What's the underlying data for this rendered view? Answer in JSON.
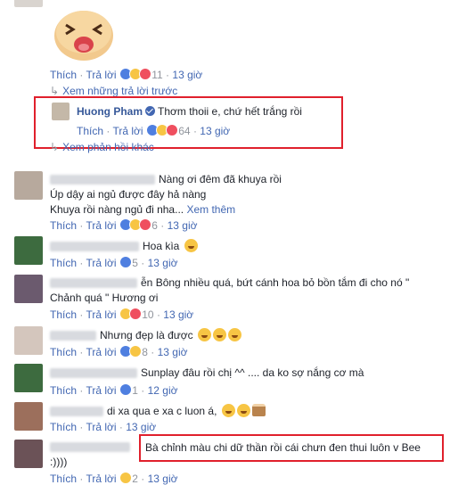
{
  "comments": {
    "sticker": {
      "actions": {
        "like": "Thích",
        "reply": "Trả lời",
        "count": "11",
        "time": "13 giờ"
      }
    },
    "prev_replies": "Xem những trả lời trước",
    "huong": {
      "author": "Huong Pham",
      "text": "Thơm thoii e, chứ hết trắng rồi",
      "actions": {
        "like": "Thích",
        "reply": "Trả lời",
        "count": "64",
        "time": "13 giờ"
      }
    },
    "other_replies": "Xem phản hồi khác",
    "c1": {
      "lines": [
        "Nàng ơi đêm đã khuya rồi",
        "Úp dậy ai ngủ được đây hả nàng",
        "Khuya rồi nàng ngủ đi nha..."
      ],
      "see_more": "Xem thêm",
      "actions": {
        "like": "Thích",
        "reply": "Trả lời",
        "count": "6",
        "time": "13 giờ"
      }
    },
    "c2": {
      "text": "Hoa kìa",
      "actions": {
        "like": "Thích",
        "reply": "Trả lời",
        "count": "5",
        "time": "13 giờ"
      }
    },
    "c3": {
      "name_suffix": "ễn",
      "lines": [
        "Bông nhiều quá, bứt cánh hoa bỏ bồn tắm đi cho nó \"",
        "Chảnh quá \" Hương ơi"
      ],
      "actions": {
        "like": "Thích",
        "reply": "Trả lời",
        "count": "10",
        "time": "13 giờ"
      }
    },
    "c4": {
      "text": "Nhưng đẹp là được",
      "actions": {
        "like": "Thích",
        "reply": "Trả lời",
        "count": "8",
        "time": "13 giờ"
      }
    },
    "c5": {
      "text": "Sunplay đâu rồi chị ^^ .... da ko sợ nắng cơ mà",
      "actions": {
        "like": "Thích",
        "reply": "Trả lời",
        "count": "1",
        "time": "12 giờ"
      }
    },
    "c6": {
      "text": "di xa qua e xa c luon á,",
      "actions": {
        "like": "Thích",
        "reply": "Trả lời",
        "count": "",
        "time": "13 giờ"
      }
    },
    "c7": {
      "lines": [
        "Bà chỉnh màu chi dữ thần rồi cái chưn đen thui luôn v Bee",
        ":))))"
      ],
      "actions": {
        "like": "Thích",
        "reply": "Trả lời",
        "count": "2",
        "time": "13 giờ"
      }
    }
  },
  "colors": {
    "link": "#4267b2",
    "meta": "#90949c",
    "highlight": "#e0202c"
  }
}
